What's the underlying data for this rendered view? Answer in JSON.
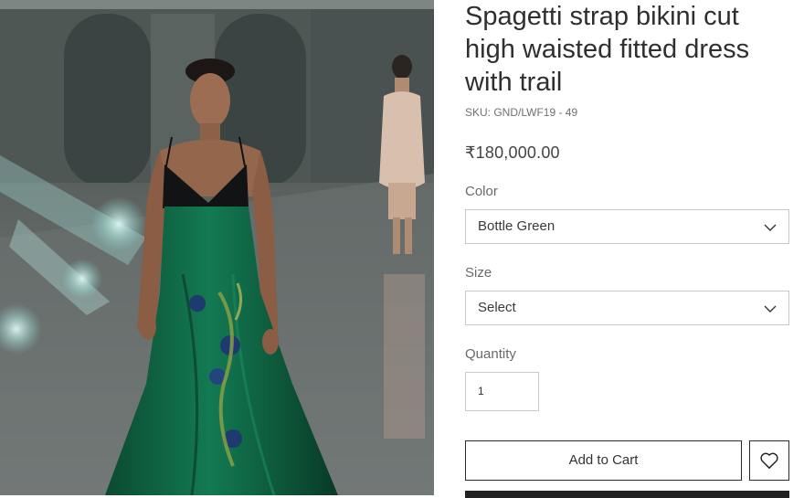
{
  "product": {
    "title": "Spagetti strap bikini cut high waisted fitted dress with trail",
    "sku": "SKU: GND/LWF19 - 49",
    "price": "₹180,000.00",
    "image_icon": "runway-model-photo"
  },
  "options": {
    "color": {
      "label": "Color",
      "selected": "Bottle Green"
    },
    "size": {
      "label": "Size",
      "selected": "Select"
    }
  },
  "quantity": {
    "label": "Quantity",
    "value": "1"
  },
  "actions": {
    "add_to_cart": "Add to Cart",
    "wishlist_icon": "heart-icon"
  },
  "colors": {
    "dress": "#0f5a3c",
    "text": "#2f2f2f",
    "border": "#c9c9c9"
  }
}
